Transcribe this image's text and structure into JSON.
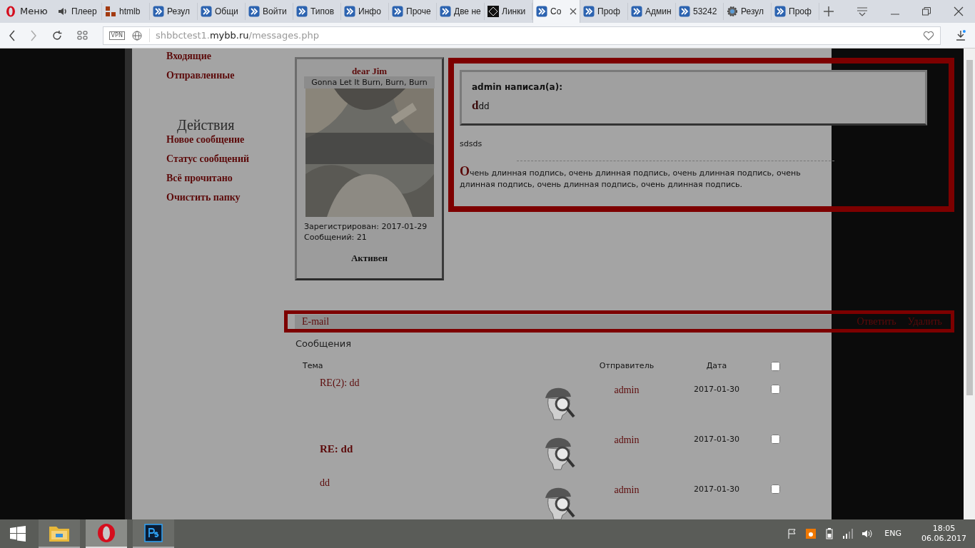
{
  "browser": {
    "menu_label": "Меню",
    "tabs": [
      {
        "label": "Плеер",
        "kind": "speaker",
        "selected": false
      },
      {
        "label": "htmlb",
        "kind": "blocks",
        "selected": false
      },
      {
        "label": "Резул",
        "kind": "forum",
        "selected": false
      },
      {
        "label": "Общи",
        "kind": "forum",
        "selected": false
      },
      {
        "label": "Войти",
        "kind": "forum",
        "selected": false
      },
      {
        "label": "Типов",
        "kind": "forum",
        "selected": false
      },
      {
        "label": "Инфо",
        "kind": "forum",
        "selected": false
      },
      {
        "label": "Проче",
        "kind": "forum",
        "selected": false
      },
      {
        "label": "Две не",
        "kind": "forum",
        "selected": false
      },
      {
        "label": "Линки",
        "kind": "diamond",
        "selected": false
      },
      {
        "label": "Со",
        "kind": "forum",
        "selected": true
      },
      {
        "label": "Проф",
        "kind": "forum",
        "selected": false
      },
      {
        "label": "Админ",
        "kind": "forum",
        "selected": false
      },
      {
        "label": "53242",
        "kind": "forum",
        "selected": false
      },
      {
        "label": "Резул",
        "kind": "gear",
        "selected": false
      },
      {
        "label": "Проф",
        "kind": "forum",
        "selected": false
      }
    ],
    "vpn_label": "VPN",
    "url": {
      "prefix": "shbbctest1.",
      "domain": "mybb.ru",
      "path": "/messages.php"
    }
  },
  "sidebar": {
    "folders": [
      "Входящие",
      "Отправленные"
    ],
    "actions_title": "Действия",
    "actions": [
      "Новое сообщение",
      "Статус сообщений",
      "Всё прочитано",
      "Очистить папку"
    ]
  },
  "profile": {
    "name": "dear Jim",
    "status_line": "Gonna Let It Burn, Burn, Burn",
    "registered": "Зарегистрирован: 2017-01-29",
    "posts": "Сообщений: 21",
    "activity": "Активен"
  },
  "post": {
    "quote_author": "admin написал(а):",
    "quote_text": "ddd",
    "body": "sdsds",
    "signature": "Очень длинная подпись, очень длинная подпись, очень длинная подпись, очень длинная подпись, очень длинная подпись, очень длинная подпись."
  },
  "actions_bar": {
    "email": "E-mail",
    "buttons": [
      "Ответить",
      "Удалить"
    ]
  },
  "messages": {
    "title": "Сообщения",
    "columns": [
      "Тема",
      "Отправитель",
      "Дата"
    ],
    "select_all": {
      "checked": false
    },
    "rows": [
      {
        "subject": "RE(2): dd",
        "unread": false,
        "sender": "admin",
        "date": "2017-01-30",
        "checked": false
      },
      {
        "subject": "RE: dd",
        "unread": true,
        "sender": "admin",
        "date": "2017-01-30",
        "checked": false
      },
      {
        "subject": "dd",
        "unread": false,
        "sender": "admin",
        "date": "2017-01-30",
        "checked": false
      }
    ]
  },
  "taskbar": {
    "apps": [
      {
        "kind": "explorer",
        "selected": false
      },
      {
        "kind": "opera",
        "selected": true
      },
      {
        "kind": "photoshop",
        "selected": false
      }
    ],
    "language": "ENG",
    "time": "18:05",
    "date": "06.06.2017"
  }
}
